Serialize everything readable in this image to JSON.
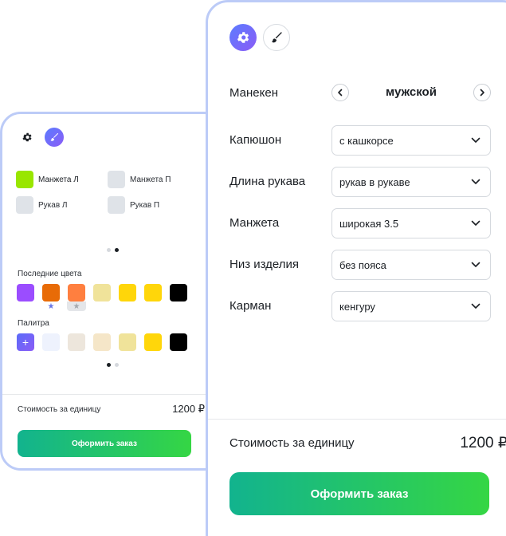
{
  "colors": {
    "accent": "#6877e6",
    "border_accent": "#bccbf7",
    "order_gradient_start": "#12b38e",
    "order_gradient_end": "#35d644"
  },
  "mobile": {
    "toolbar": {
      "settings_icon": "gear-icon",
      "brush_icon": "brush-icon",
      "active": "brush"
    },
    "parts": [
      {
        "label": "Манжета Л",
        "color": "#99e600",
        "selected": true
      },
      {
        "label": "Манжета П",
        "color": "#dfe3e8",
        "selected": false
      },
      {
        "label": "Рукав Л",
        "color": "#dfe3e8",
        "selected": false
      },
      {
        "label": "Рукав П",
        "color": "#dfe3e8",
        "selected": false
      }
    ],
    "parts_page": {
      "current": 2,
      "total": 2
    },
    "recent": {
      "title": "Последние цвета",
      "colors": [
        "#9b4dff",
        "#e86b07",
        "#ff7f3f",
        "#f0e39a",
        "#ffd60a",
        "#ffd60a",
        "#000000"
      ],
      "favorites": [
        {
          "index": 1,
          "style": "accent"
        },
        {
          "index": 2,
          "style": "grey"
        }
      ]
    },
    "palette": {
      "title": "Палитра",
      "add_label": "+",
      "colors": [
        "#eef2fd",
        "#ede6dc",
        "#f5e6c8",
        "#f0e39a",
        "#ffd60a",
        "#000000"
      ]
    },
    "palette_page": {
      "current": 1,
      "total": 2
    },
    "cost_label": "Стоимость за единицу",
    "cost_value": "1200 ₽",
    "order_label": "Оформить заказ"
  },
  "main": {
    "toolbar": {
      "settings_icon": "gear-icon",
      "brush_icon": "brush-icon",
      "active": "settings"
    },
    "mannequin": {
      "label": "Манекен",
      "value": "мужской"
    },
    "fields": [
      {
        "label": "Капюшон",
        "value": "с кашкорсе"
      },
      {
        "label": "Длина рукава",
        "value": "рукав в рукаве"
      },
      {
        "label": "Манжета",
        "value": "широкая 3.5"
      },
      {
        "label": "Низ изделия",
        "value": "без пояса"
      },
      {
        "label": "Карман",
        "value": "кенгуру"
      }
    ],
    "cost_label": "Стоимость за единицу",
    "cost_value": "1200 ₽",
    "order_label": "Оформить заказ"
  }
}
